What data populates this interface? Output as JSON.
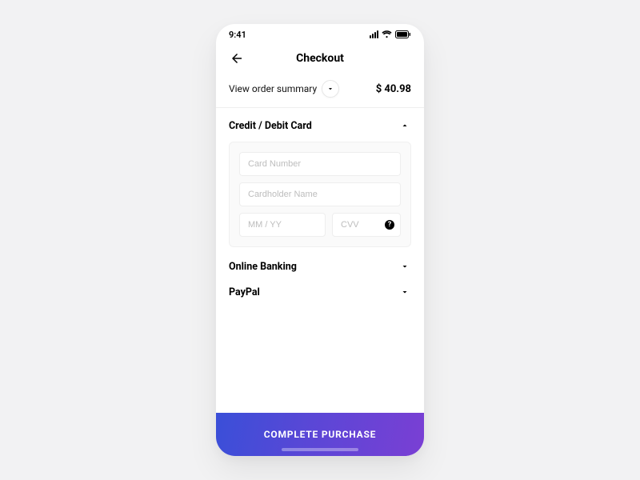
{
  "status": {
    "time": "9:41"
  },
  "header": {
    "title": "Checkout"
  },
  "summary": {
    "label": "View order summary",
    "total": "$ 40.98"
  },
  "payment": {
    "card": {
      "title": "Credit / Debit Card",
      "placeholders": {
        "number": "Card Number",
        "name": "Cardholder Name",
        "expiry": "MM / YY",
        "cvv": "CVV"
      },
      "help_symbol": "?"
    },
    "banking": {
      "title": "Online Banking"
    },
    "paypal": {
      "title": "PayPal"
    }
  },
  "cta": {
    "label": "COMPLETE PURCHASE"
  }
}
